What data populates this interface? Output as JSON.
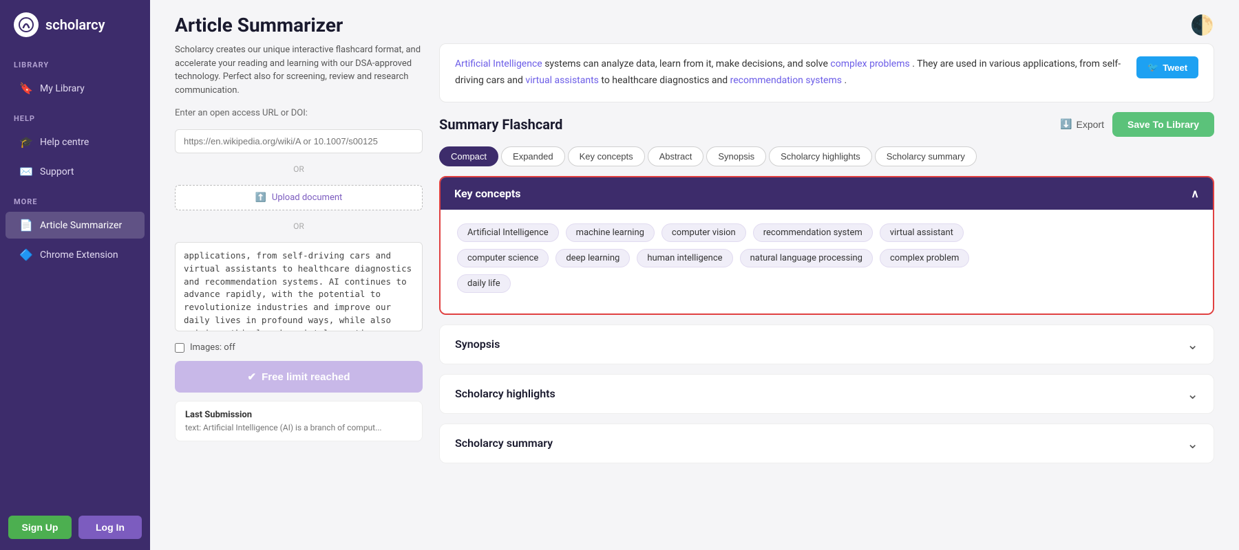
{
  "app": {
    "name": "scholarcy",
    "logo_letter": "S",
    "page_title": "Article Summarizer",
    "theme_icon": "🌓"
  },
  "sidebar": {
    "library_label": "LIBRARY",
    "my_library": "My Library",
    "help_label": "HELP",
    "help_centre": "Help centre",
    "support": "Support",
    "more_label": "MORE",
    "article_summarizer": "Article Summarizer",
    "chrome_extension": "Chrome Extension",
    "signup_label": "Sign Up",
    "login_label": "Log In"
  },
  "left": {
    "description": "Scholarcy creates our unique interactive flashcard format, and accelerate your reading and learning with our DSA-approved technology. Perfect also for screening, review and research communication.",
    "url_label": "Enter an open access URL or DOI:",
    "url_placeholder": "https://en.wikipedia.org/wiki/A or 10.1007/s00125",
    "or_text": "OR",
    "upload_label": "Upload document",
    "or_text2": "OR",
    "article_body": "applications, from self-driving cars and virtual assistants to healthcare diagnostics and recommendation systems. AI continues to advance rapidly, with the potential to revolutionize industries and improve our daily lives in profound ways, while also raising ethical and societal questions.",
    "images_label": "Images: off",
    "free_limit_label": "Free limit reached",
    "last_submission_title": "Last Submission",
    "last_submission_text": "text: Artificial Intelligence (AI) is a branch of comput..."
  },
  "right": {
    "ai_summary": {
      "text_parts": [
        {
          "text": "Artificial Intelligence",
          "link": true
        },
        {
          "text": " systems can analyze data, learn from it, make decisions, and solve "
        },
        {
          "text": "complex problems",
          "link": true
        },
        {
          "text": ". They are used in various applications, from self-driving cars and "
        },
        {
          "text": "virtual assistants",
          "link": true
        },
        {
          "text": " to healthcare diagnostics and "
        },
        {
          "text": "recommendation systems",
          "link": true
        },
        {
          "text": "."
        }
      ],
      "tweet_label": "Tweet"
    },
    "flashcard_title": "Summary Flashcard",
    "export_label": "Export",
    "save_library_label": "Save To Library",
    "tabs": [
      {
        "label": "Compact",
        "active": true
      },
      {
        "label": "Expanded",
        "active": false
      },
      {
        "label": "Key concepts",
        "active": false
      },
      {
        "label": "Abstract",
        "active": false
      },
      {
        "label": "Synopsis",
        "active": false
      },
      {
        "label": "Scholarcy highlights",
        "active": false
      },
      {
        "label": "Scholarcy summary",
        "active": false
      }
    ],
    "key_concepts": {
      "title": "Key concepts",
      "chevron": "∧",
      "tags": [
        "Artificial Intelligence",
        "machine learning",
        "computer vision",
        "recommendation system",
        "virtual assistant",
        "computer science",
        "deep learning",
        "human intelligence",
        "natural language processing",
        "complex problem",
        "daily life"
      ]
    },
    "accordions": [
      {
        "title": "Synopsis"
      },
      {
        "title": "Scholarcy highlights"
      },
      {
        "title": "Scholarcy summary"
      }
    ]
  }
}
